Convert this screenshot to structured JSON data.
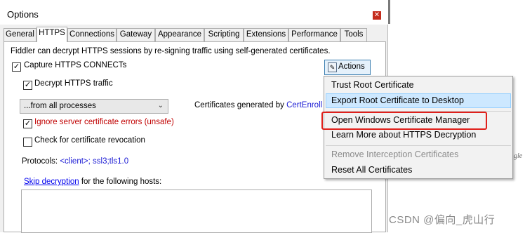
{
  "window": {
    "title": "Options",
    "close_glyph": "✕"
  },
  "tabs": [
    {
      "label": "General"
    },
    {
      "label": "HTTPS",
      "active": true
    },
    {
      "label": "Connections"
    },
    {
      "label": "Gateway"
    },
    {
      "label": "Appearance"
    },
    {
      "label": "Scripting"
    },
    {
      "label": "Extensions"
    },
    {
      "label": "Performance"
    },
    {
      "label": "Tools"
    }
  ],
  "panel": {
    "intro": "Fiddler can decrypt HTTPS sessions by re-signing traffic using self-generated certificates.",
    "capture_https": {
      "label": "Capture HTTPS CONNECTs",
      "checked": true
    },
    "decrypt_https": {
      "label": "Decrypt HTTPS traffic",
      "checked": true
    },
    "process_filter": {
      "selected": "...from all processes"
    },
    "certs_generated_prefix": "Certificates generated by",
    "certs_generated_engine": "CertEnroll",
    "ignore_errors": {
      "label": "Ignore server certificate errors (unsafe)",
      "checked": true
    },
    "check_revocation": {
      "label": "Check for certificate revocation",
      "checked": false
    },
    "protocols_label": "Protocols:",
    "protocols_value": "<client>; ssl3;tls1.0",
    "skip_link": "Skip decryption",
    "skip_suffix": "for the following hosts:",
    "hosts_value": ""
  },
  "actions": {
    "button_label": "Actions",
    "menu_items": [
      {
        "label": "Trust Root Certificate",
        "enabled": true
      },
      {
        "label": "Export Root Certificate to Desktop",
        "enabled": true,
        "highlighted": true
      },
      {
        "label": "Open Windows Certificate Manager",
        "enabled": true,
        "annotated": true
      },
      {
        "label": "Learn More about HTTPS Decryption",
        "enabled": true
      },
      {
        "label": "Remove Interception Certificates",
        "enabled": false
      },
      {
        "label": "Reset All Certificates",
        "enabled": true
      }
    ]
  },
  "background": {
    "partial_text": "gle",
    "watermark": "CSDN @偏向_虎山行"
  },
  "colors": {
    "highlight": "#cde8ff",
    "annotation_red": "#e0201b",
    "link_blue": "#0000ee",
    "error_red": "#c00000"
  }
}
